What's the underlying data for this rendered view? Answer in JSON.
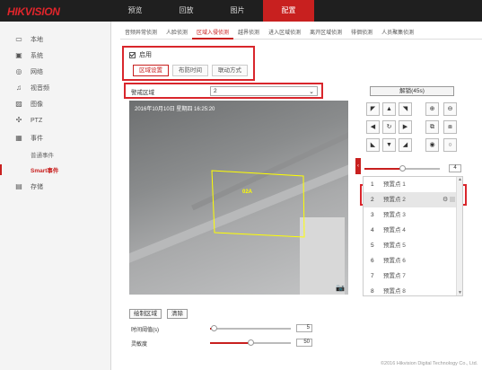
{
  "brand": {
    "logo": "HIKVISION",
    "accent": "#c8201f"
  },
  "topnav": [
    "预览",
    "回放",
    "图片",
    "配置"
  ],
  "topnav_active": "配置",
  "sidebar": {
    "items": [
      {
        "label": "本地",
        "icon": "monitor-icon"
      },
      {
        "label": "系统",
        "icon": "system-icon"
      },
      {
        "label": "网络",
        "icon": "network-icon"
      },
      {
        "label": "视音频",
        "icon": "video-audio-icon"
      },
      {
        "label": "图像",
        "icon": "image-icon"
      },
      {
        "label": "PTZ",
        "icon": "ptz-icon"
      },
      {
        "label": "事件",
        "icon": "event-icon"
      },
      {
        "label": "普通事件",
        "icon": ""
      },
      {
        "label": "Smart事件",
        "icon": ""
      },
      {
        "label": "存储",
        "icon": "storage-icon"
      }
    ]
  },
  "tabs": [
    "音频异常侦测",
    "人脸侦测",
    "区域入侵侦测",
    "越界侦测",
    "进入区域侦测",
    "离开区域侦测",
    "徘徊侦测",
    "人员聚集侦测"
  ],
  "active_tab": "区域入侵侦测",
  "enable_label": "启用",
  "subtabs": [
    "区域设置",
    "布防时间",
    "联动方式"
  ],
  "region_select": {
    "label": "警戒区域",
    "value": "2"
  },
  "video": {
    "timestamp": "2016年10月10日 星期四 16:25:20",
    "region_label": "02A"
  },
  "buttons": {
    "draw": "绘制区域",
    "clear": "清除"
  },
  "sliders": [
    {
      "label": "时间阈值(s)",
      "value": "5",
      "level": 0.05
    },
    {
      "label": "灵敏度",
      "value": "50",
      "level": 0.5
    }
  ],
  "ptz": {
    "unlock_label": "解锁(45s)",
    "speed": "4",
    "speed_level": 0.5,
    "presets": [
      {
        "num": "1",
        "name": "预置点 1"
      },
      {
        "num": "2",
        "name": "预置点 2"
      },
      {
        "num": "3",
        "name": "预置点 3"
      },
      {
        "num": "4",
        "name": "预置点 4"
      },
      {
        "num": "5",
        "name": "预置点 5"
      },
      {
        "num": "6",
        "name": "预置点 6"
      },
      {
        "num": "7",
        "name": "预置点 7"
      },
      {
        "num": "8",
        "name": "预置点 8"
      }
    ],
    "selected_preset": "2"
  },
  "footer": "©2016 Hikvision Digital Technology Co., Ltd."
}
